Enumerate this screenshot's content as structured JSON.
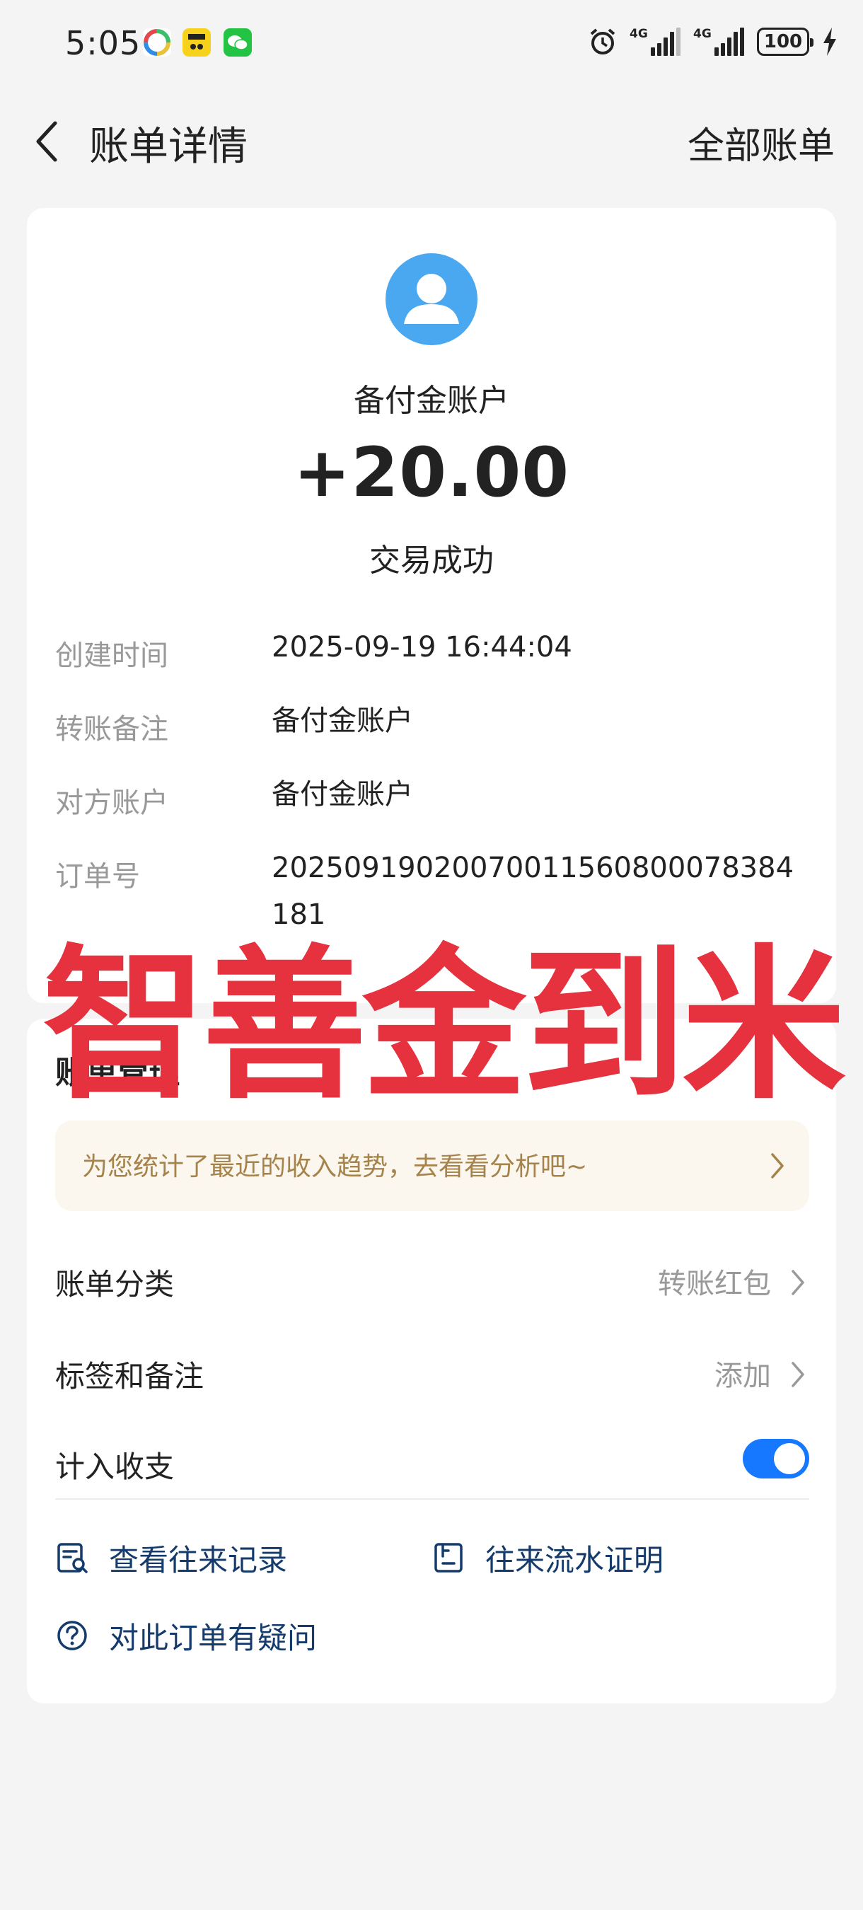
{
  "status_bar": {
    "time": "5:05",
    "network_1": "4G",
    "network_2": "4G",
    "battery": "100"
  },
  "nav": {
    "title": "账单详情",
    "all_bills": "全部账单"
  },
  "transaction": {
    "account_name": "备付金账户",
    "amount": "+20.00",
    "status": "交易成功",
    "details": [
      {
        "label": "创建时间",
        "value": "2025-09-19 16:44:04"
      },
      {
        "label": "转账备注",
        "value": "备付金账户"
      },
      {
        "label": "对方账户",
        "value": "备付金账户"
      },
      {
        "label": "订单号",
        "value": "20250919020070011560800078384181"
      }
    ]
  },
  "management": {
    "title": "账单管理",
    "tip": "为您统计了最近的收入趋势，去看看分析吧~",
    "category_label": "账单分类",
    "category_value": "转账红包",
    "tags_label": "标签和备注",
    "tags_value": "添加",
    "include_label": "计入收支",
    "include_enabled": true,
    "link_records": "查看往来记录",
    "link_proof": "往来流水证明",
    "link_question": "对此订单有疑问"
  },
  "watermark": "智善金到米",
  "colors": {
    "accent_blue": "#1677ff",
    "avatar_blue": "#4aa8f0",
    "watermark_red": "#e5323e",
    "link_navy": "#143b6b",
    "tip_text": "#a5834a"
  }
}
